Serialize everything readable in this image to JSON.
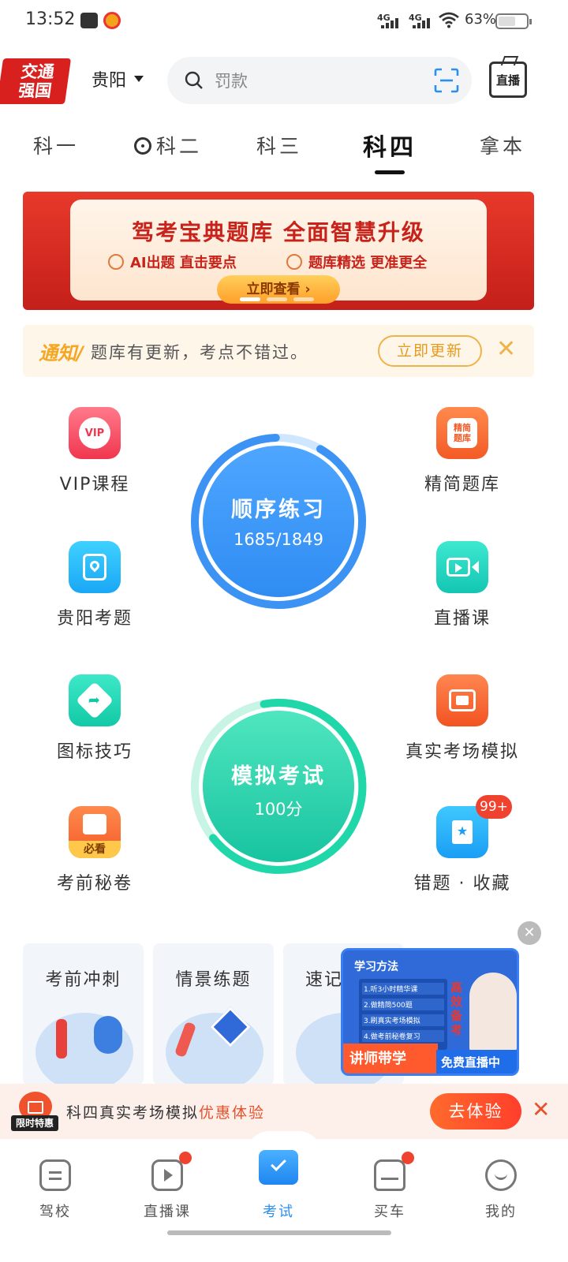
{
  "status": {
    "time": "13:52",
    "signal1": "4G",
    "signal2": "4G",
    "battery_pct": "63%",
    "battery_level": 0.63
  },
  "header": {
    "logo_line1": "交通",
    "logo_line2": "强国",
    "city": "贵阳",
    "search_placeholder": "罚款",
    "live_label": "直播"
  },
  "tabs": [
    {
      "label": "科一"
    },
    {
      "label": "科二"
    },
    {
      "label": "科三"
    },
    {
      "label": "科四",
      "active": true
    },
    {
      "label": "拿本"
    }
  ],
  "banner": {
    "title": "驾考宝典题库 全面智慧升级",
    "point1": "AI出题 直击要点",
    "point2": "题库精选 更准更全",
    "cta": "立即查看 ›"
  },
  "notice": {
    "tag": "通知/",
    "message": "题库有更新，考点不错过。",
    "button": "立即更新",
    "close": "✕"
  },
  "features": {
    "vip": "VIP课程",
    "jingjian": "精简题库",
    "jingjian_icon_text": "精简\n题库",
    "local": "贵阳考题",
    "live": "直播课",
    "sign": "图标技巧",
    "real": "真实考场模拟",
    "secret": "考前秘卷",
    "secret_badge": "必看",
    "wrong": "错题 · 收藏",
    "wrong_badge": "99+"
  },
  "practice": {
    "title": "顺序练习",
    "progress": "1685/1849",
    "done": 1685,
    "total": 1849
  },
  "exam": {
    "title": "模拟考试",
    "score": "100分"
  },
  "cards": [
    {
      "label": "考前冲刺"
    },
    {
      "label": "情景练题"
    },
    {
      "label": "速记"
    }
  ],
  "pip": {
    "title": "学习方法",
    "items": [
      "1.听3小时精华课",
      "2.做精简500题",
      "3.刷真实考场模拟",
      "4.做考前秘卷复习"
    ],
    "side_text": "高效备考",
    "badge_left": "讲师带学",
    "badge_right": "免费直播中",
    "close": "✕"
  },
  "promo": {
    "tag": "限时特惠",
    "text": "科四真实考场模拟",
    "highlight": "优惠体验",
    "button": "去体验",
    "close": "✕"
  },
  "nav": [
    {
      "label": "驾校"
    },
    {
      "label": "直播课"
    },
    {
      "label": "考试",
      "active": true
    },
    {
      "label": "买车"
    },
    {
      "label": "我的"
    }
  ],
  "colors": {
    "accent_blue": "#2a8ff0",
    "accent_orange": "#ff5a2d",
    "exam_green": "#1fd7a8"
  }
}
